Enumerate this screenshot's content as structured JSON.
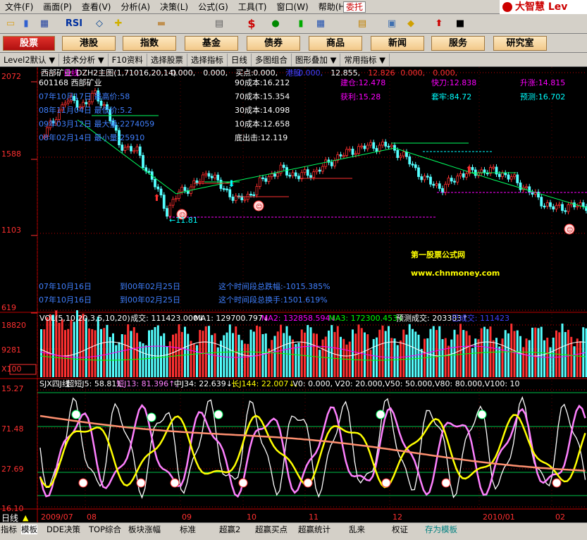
{
  "menu": [
    "文件(F)",
    "画面(P)",
    "查看(V)",
    "分析(A)",
    "决策(L)",
    "公式(G)",
    "工具(T)",
    "窗口(W)",
    "帮助(H)"
  ],
  "weituo": "委托",
  "brand": "大智慧 Lev",
  "toolbar_icons": [
    "open-folder-icon",
    "candlestick-chart-icon",
    "grid-icon",
    "rsi-icon",
    "fork-icon",
    "crosshair-icon",
    "ruler-icon",
    "print-icon",
    "dollar-icon",
    "tri-color-icon",
    "green-bars-icon",
    "calendar-icon",
    "stack-icon",
    "book-icon",
    "diamond-icon",
    "red-arrow-icon",
    "dark-window-icon"
  ],
  "toolbar_rsi": "RSI",
  "toolbar_dollar": "$",
  "nav": [
    "股票",
    "港股",
    "指数",
    "基金",
    "债券",
    "商品",
    "新闻",
    "服务",
    "研究室"
  ],
  "funcbar": [
    "Level2默认",
    "技术分析",
    "F10资料",
    "选择股票",
    "选择指标",
    "日线",
    "多图组合",
    "图形叠加",
    "常用指标"
  ],
  "price_axis": [
    "2072",
    "1588",
    "1103",
    "619"
  ],
  "main_header": {
    "stock": "西部矿业",
    "period": "日线",
    "formula": "DZH2主图(1,71016,20,14)",
    "v1": "0.000,",
    "v2": "0.000,",
    "buy_label": "买点:",
    "buy_val": "0.000,",
    "gang": "港股",
    "gv1": "0.000,",
    "gv2": "12.855,",
    "gv3": "12.826",
    "gv4": "0.000,",
    "gv5": "0.000,"
  },
  "info_left": [
    "601168 西部矿业",
    "07年10月17日 最高价:58",
    "08年11月04日 最低价:5.2",
    "09年03月12日 最大量:2274059",
    "08年02月14日 最小量:25910"
  ],
  "cost_list": [
    "90成本:16.212",
    "70成本:15.354",
    "30成本:14.098",
    "10成本:12.658",
    "底出击:12.119"
  ],
  "right_info": {
    "jiancang": "建仓:12.478",
    "huoli": "获利:15.28",
    "kuaidao": "快刀:12.838",
    "taolao": "套牢:84.72",
    "shengzhang": "升涨:14.815",
    "yuce": "预测:16.702"
  },
  "low_label": "←11.81",
  "watermark": {
    "title": "第一股票公式网",
    "url": "www.chnmoney.com"
  },
  "range_stats": [
    {
      "start": "07年10月16日",
      "end": "到00年02月25日",
      "text": "这个时间段总跌幅:-1015.385%"
    },
    {
      "start": "07年10月16日",
      "end": "到00年02月25日",
      "text": "这个时间段总换手:1501.619%"
    }
  ],
  "vol_axis": [
    "18820",
    "9281",
    "X100"
  ],
  "vol_header": {
    "params": "VOL(5,10,20,3,5,10,20)",
    "cj": "成交: 111423.000",
    "ma1": "MA1: 129700.797",
    "ma2": "MA2: 132858.594",
    "ma3": "MA3: 172300.453",
    "yc": "预测成交: 203383",
    "yi": "已成交: 111423"
  },
  "sub_axis": [
    "15.27",
    "71.48",
    "27.69",
    "16.10"
  ],
  "sub_header": {
    "name": "SJX四J线",
    "cd": "超短J5: 58.811",
    "dj": "短J13: 81.396",
    "zj": "中J34: 22.639",
    "cj": "长J144: 22.007",
    "v0": "V0: 0.000,",
    "v20": "V20: 20.000,",
    "v50": "V50: 50.000,",
    "v80": "V80: 80.000,",
    "v100": "V100: 10"
  },
  "date_axis": [
    "2009/07",
    "08",
    "09",
    "10",
    "11",
    "12",
    "2010/01",
    "02"
  ],
  "bottom_period": "日线",
  "bottom_tabs": [
    "指标",
    "模板",
    "DDE决策",
    "TOP综合",
    "板块涨幅",
    "标准",
    "超赢2",
    "超赢买点",
    "超赢统计",
    "乱来",
    "权证",
    "存为模板"
  ],
  "colors": {
    "up": "#ff3030",
    "down": "#54ffff",
    "cyan": "#00ffff",
    "magenta": "#ff00ff",
    "yellow": "#ffff00",
    "white": "#ffffff",
    "orange": "#ffa060",
    "pink": "#ff80ff"
  }
}
